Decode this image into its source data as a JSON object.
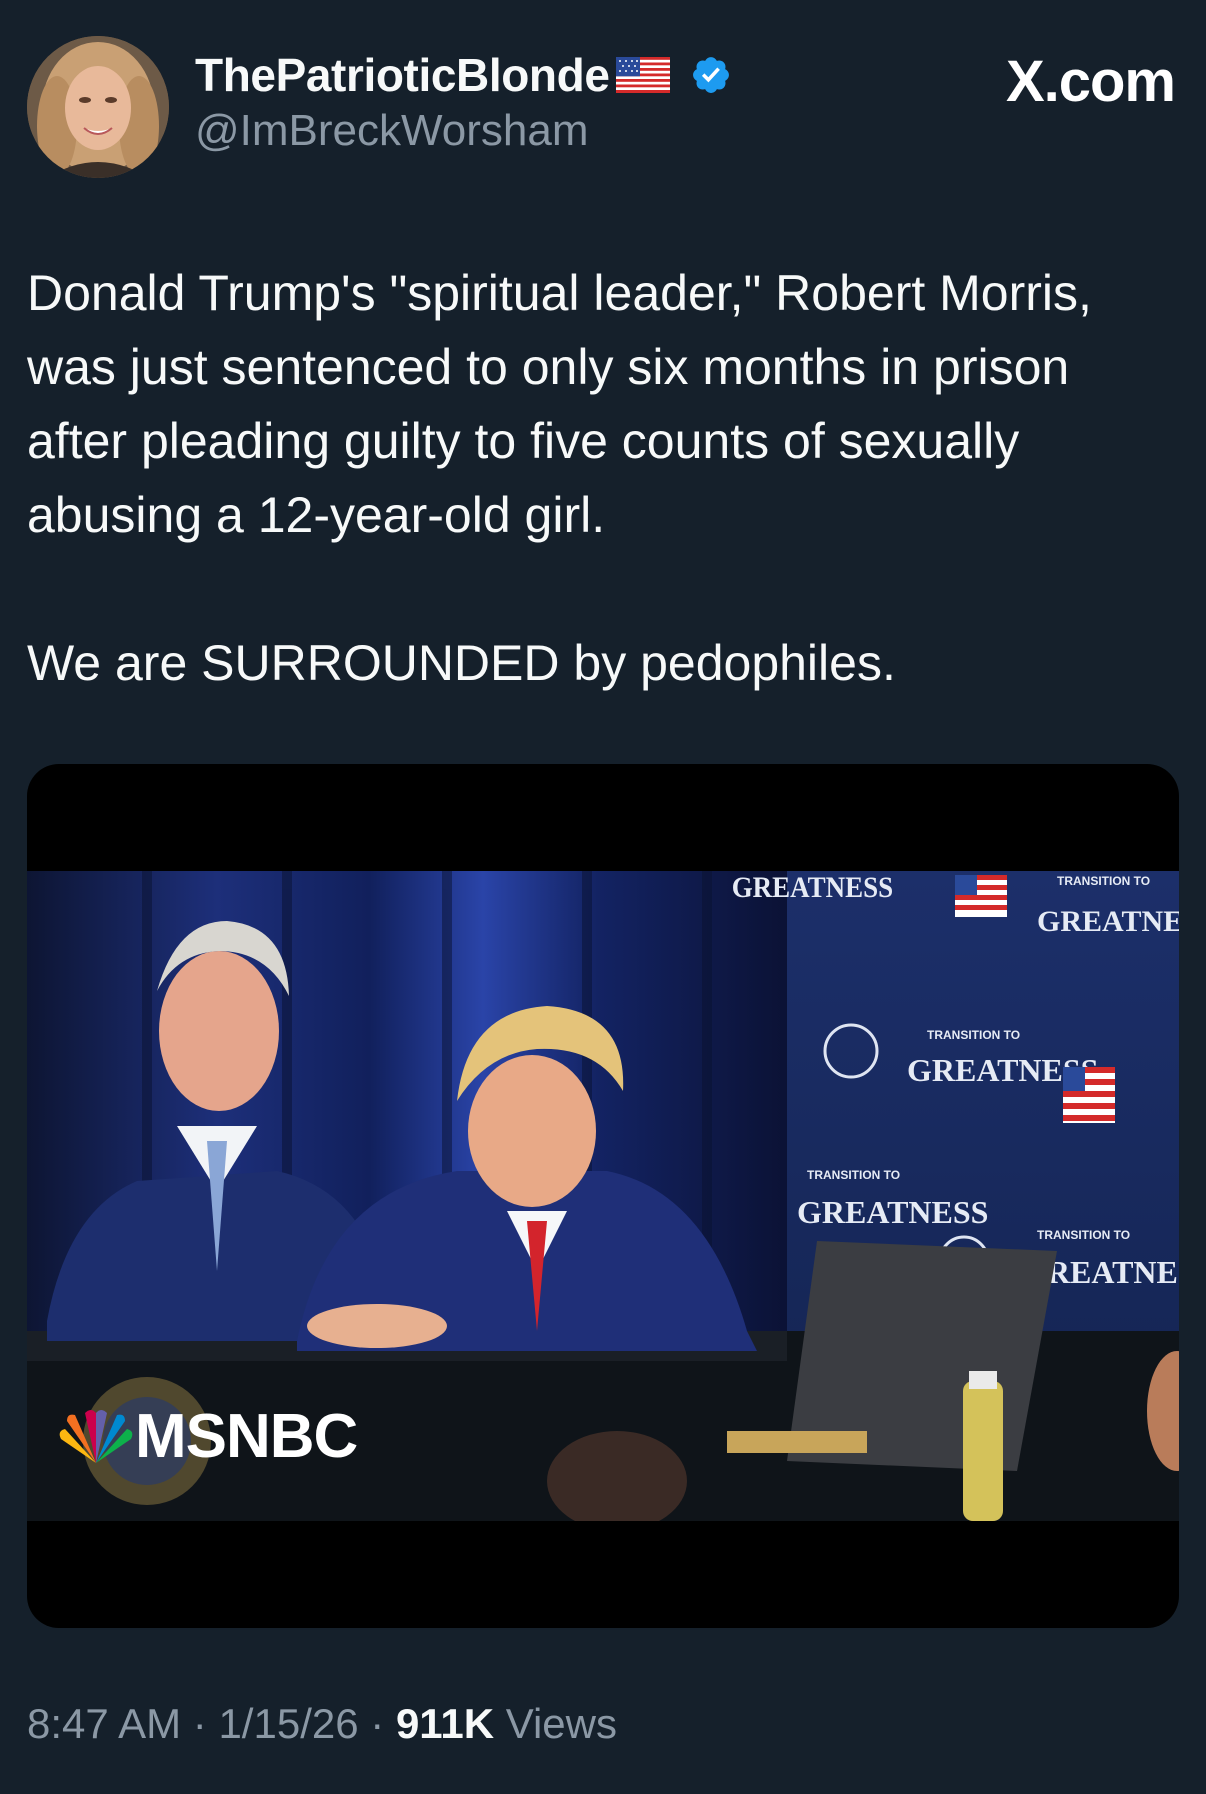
{
  "author": {
    "display_name": "ThePatrioticBlonde",
    "handle": "@ImBreckWorsham",
    "flag_emoji": "us-flag",
    "verified": true
  },
  "site_label": "X.com",
  "tweet": {
    "paragraphs": [
      "Donald Trump's \"spiritual leader,\" Robert Morris, was just sentenced to only six months in prison after pleading guilty to five counts of sexually abusing a 12-year-old girl.",
      "We are SURROUNDED by pedophiles."
    ]
  },
  "media": {
    "watermark": "MSNBC",
    "backdrop_texts": [
      "TRANSITION TO",
      "GREATNESS"
    ]
  },
  "meta": {
    "time": "8:47 AM",
    "date": "1/15/26",
    "separator": "·",
    "views_count": "911K",
    "views_label": "Views"
  },
  "colors": {
    "background": "#15202b",
    "text": "#f7f9f9",
    "secondary_text": "#8b98a5",
    "verified_badge": "#1d9bf0"
  }
}
